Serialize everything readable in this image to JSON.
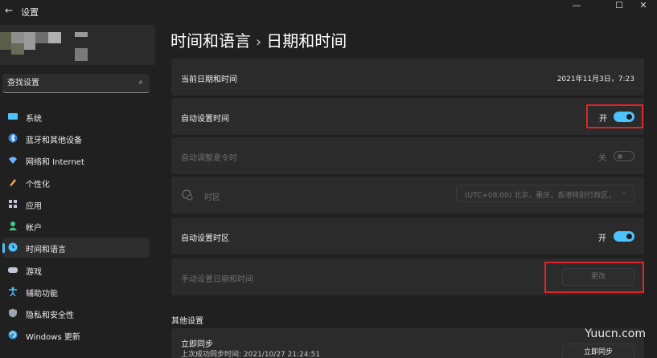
{
  "window": {
    "app_title": "设置",
    "back_glyph": "←",
    "minimize_glyph": "—",
    "maximize_glyph": "☐",
    "close_glyph": "✕"
  },
  "search": {
    "placeholder": "查找设置",
    "icon": "search-icon",
    "glyph": "⌕"
  },
  "sidebar": {
    "items": [
      {
        "label": "系统",
        "icon": "system-icon"
      },
      {
        "label": "蓝牙和其他设备",
        "icon": "bluetooth-icon"
      },
      {
        "label": "网络和 Internet",
        "icon": "wifi-icon"
      },
      {
        "label": "个性化",
        "icon": "brush-icon"
      },
      {
        "label": "应用",
        "icon": "apps-icon"
      },
      {
        "label": "帐户",
        "icon": "account-icon"
      },
      {
        "label": "时间和语言",
        "icon": "time-language-icon",
        "active": true
      },
      {
        "label": "游戏",
        "icon": "gamepad-icon"
      },
      {
        "label": "辅助功能",
        "icon": "accessibility-icon"
      },
      {
        "label": "隐私和安全性",
        "icon": "shield-icon"
      },
      {
        "label": "Windows 更新",
        "icon": "update-icon"
      }
    ]
  },
  "header": {
    "breadcrumb_parent": "时间和语言",
    "breadcrumb_sep": "›",
    "breadcrumb_current": "日期和时间"
  },
  "settings": {
    "current": {
      "label": "当前日期和时间",
      "value": "2021年11月3日，7:23"
    },
    "auto_time": {
      "label": "自动设置时间",
      "state": "开",
      "on": true
    },
    "dst": {
      "label": "自动调整夏令时",
      "state": "关",
      "on": false,
      "disabled": true
    },
    "timezone": {
      "label": "时区",
      "value": "(UTC+08:00) 北京，重庆，香港特别行政区，",
      "chevron": "⌄",
      "disabled": true
    },
    "auto_timezone": {
      "label": "自动设置时区",
      "state": "开",
      "on": true
    },
    "manual": {
      "label": "手动设置日期和时间",
      "button": "更改",
      "disabled": true
    }
  },
  "other": {
    "title": "其他设置",
    "sync_title": "立即同步",
    "sync_detail": "上次成功同步时间: 2021/10/27 21:24:51",
    "sync_button": "立即同步"
  },
  "watermark": "Yuucn.com",
  "colors": {
    "accent": "#4cc2ff",
    "background": "#202020",
    "card": "#2b2b2b",
    "highlight_box": "#e0242c"
  }
}
